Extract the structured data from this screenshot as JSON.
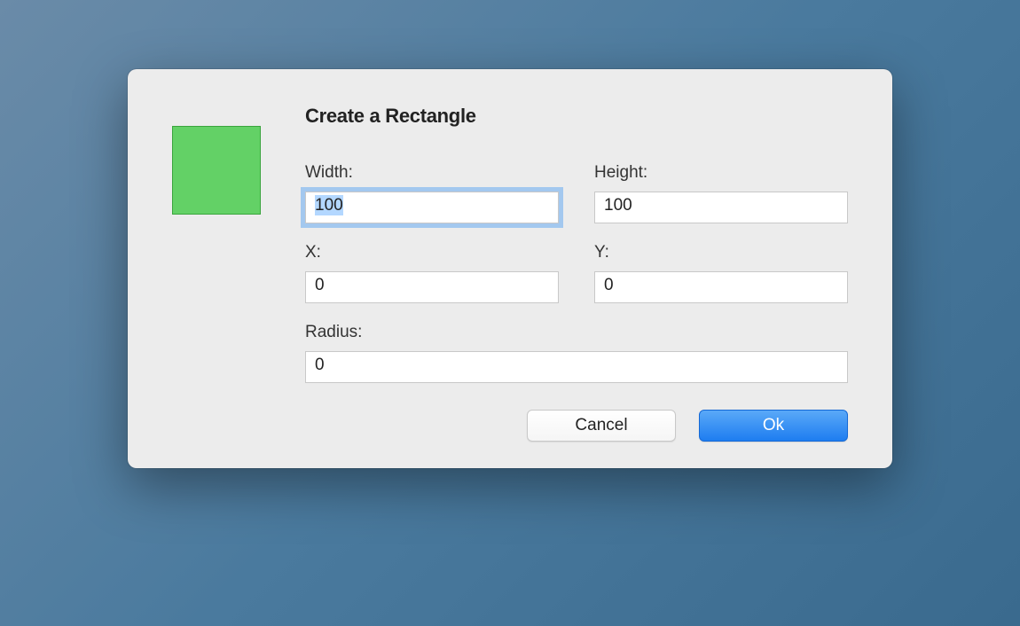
{
  "dialog": {
    "title": "Create a Rectangle",
    "preview": {
      "fill": "#63d166",
      "border": "#3aa53d"
    },
    "fields": {
      "width": {
        "label": "Width:",
        "value": "100"
      },
      "height": {
        "label": "Height:",
        "value": "100"
      },
      "x": {
        "label": "X:",
        "value": "0"
      },
      "y": {
        "label": "Y:",
        "value": "0"
      },
      "radius": {
        "label": "Radius:",
        "value": "0"
      }
    },
    "buttons": {
      "cancel": "Cancel",
      "ok": "Ok"
    }
  }
}
